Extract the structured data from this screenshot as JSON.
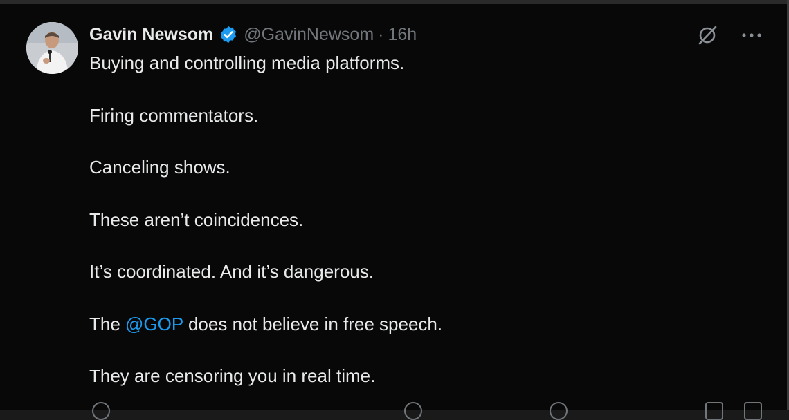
{
  "author": {
    "name": "Gavin Newsom",
    "handle": "@GavinNewsom",
    "separator": "·",
    "time": "16h",
    "verified": true,
    "verified_color": "#1d9bf0"
  },
  "icons": {
    "avatar": "avatar-photo",
    "verified": "verified-badge-icon",
    "grok": "grok-icon",
    "more": "more-options-icon"
  },
  "body": {
    "line1": "Buying and controlling media platforms.",
    "line2": "Firing commentators.",
    "line3": "Canceling shows.",
    "line4": "These aren’t coincidences.",
    "line5": "It’s coordinated. And it’s dangerous.",
    "line6_pre": "The ",
    "line6_mention": "@GOP",
    "line6_post": " does not believe in free speech.",
    "line7": "They are censoring you in real time."
  },
  "colors": {
    "background": "#080808",
    "text": "#e7e9ea",
    "muted": "#71767b",
    "link": "#1d9bf0"
  }
}
